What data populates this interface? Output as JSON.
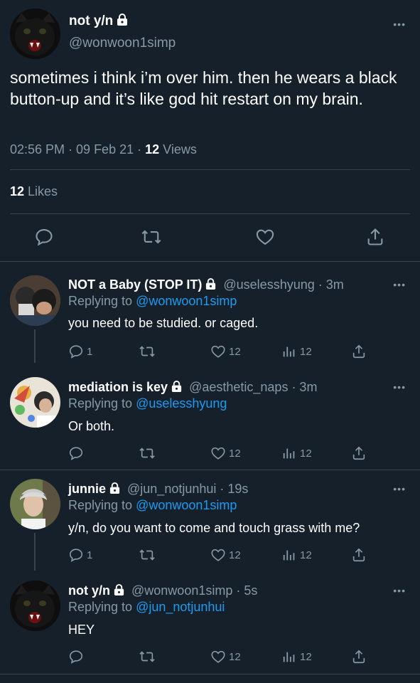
{
  "main_tweet": {
    "name": "not y/n",
    "handle": "@wonwoon1simp",
    "text": "sometimes i think i’m over him. then he wears a black button-up and it’s like god hit restart on my brain.",
    "time": "02:56 PM · 09 Feb 21 · ",
    "views_count": "12",
    "views_label": " Views",
    "likes_count": "12",
    "likes_label": " Likes",
    "more": "•••"
  },
  "replies": [
    {
      "name": "NOT a Baby (STOP IT)",
      "handle_time": "@uselesshyung · 3m",
      "replying_prefix": "Replying to ",
      "replying_to": "@wonwoon1simp",
      "text": "you need to be studied. or caged.",
      "reply_count": "1",
      "like_count": "12",
      "view_count": "12"
    },
    {
      "name": "mediation is key",
      "handle_time": "@aesthetic_naps · 3m",
      "replying_prefix": "Replying to ",
      "replying_to": "@uselesshyung",
      "text": "Or both.",
      "reply_count": "",
      "like_count": "12",
      "view_count": "12"
    },
    {
      "name": "junnie",
      "handle_time": "@jun_notjunhui · 19s",
      "replying_prefix": "Replying to ",
      "replying_to": "@wonwoon1simp",
      "text": "y/n, do you want to come and touch grass with me?",
      "reply_count": "1",
      "like_count": "12",
      "view_count": "12"
    },
    {
      "name": "not y/n",
      "handle_time": "@wonwoon1simp · 5s",
      "replying_prefix": "Replying to ",
      "replying_to": "@jun_notjunhui",
      "text": "HEY",
      "reply_count": "",
      "like_count": "12",
      "view_count": "12"
    }
  ],
  "icons": {
    "reply": "reply-icon",
    "retweet": "retweet-icon",
    "like": "like-icon",
    "views": "views-icon",
    "share": "share-icon",
    "lock": "lock-icon"
  },
  "colors": {
    "background": "#15202b",
    "muted": "#8899a6",
    "link": "#1d9bf0",
    "divider": "#38444d"
  }
}
